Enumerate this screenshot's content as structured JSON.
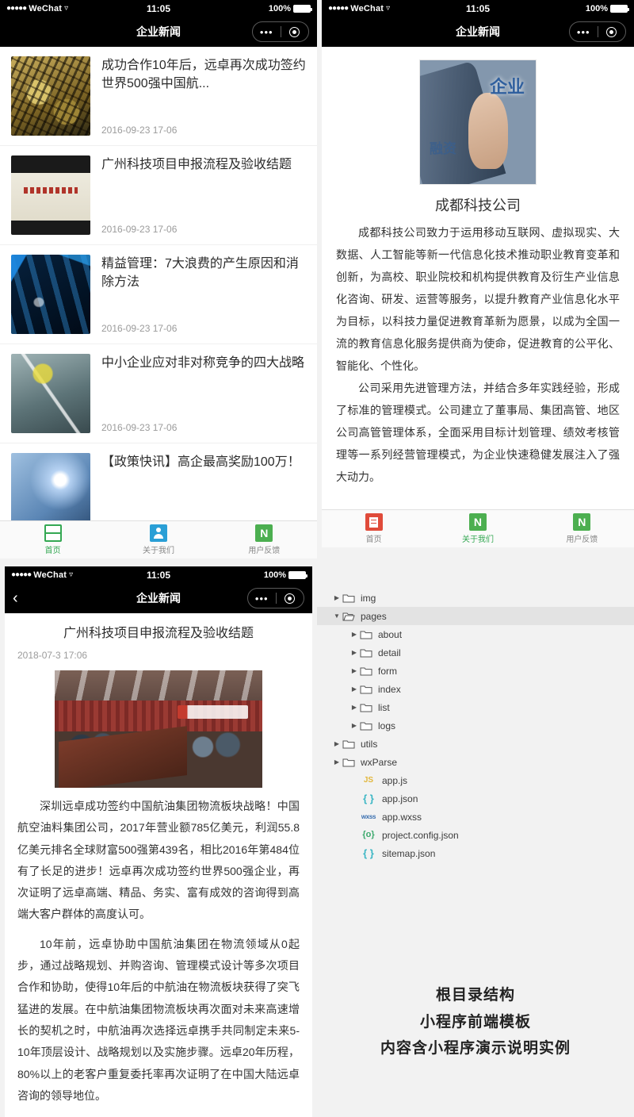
{
  "status_bar": {
    "carrier_dots": "●●●●●",
    "carrier": "WeChat",
    "wifi_icon": "wifi-icon",
    "time": "11:05",
    "battery_percent": "100%"
  },
  "capsule": {
    "menu_icon": "more-dots-icon",
    "close_icon": "target-circle-icon"
  },
  "panel_list": {
    "nav_title": "企业新闻",
    "items": [
      {
        "title": "成功合作10年后，远卓再次成功签约世界500强中国航...",
        "date": "2016-09-23 17-06",
        "thumb": "circuit-board-thumb"
      },
      {
        "title": "广州科技项目申报流程及验收结题",
        "date": "2016-09-23 17-06",
        "thumb": "award-sign-thumb"
      },
      {
        "title": "精益管理：7大浪费的产生原因和消除方法",
        "date": "2016-09-23 17-06",
        "thumb": "blue-touch-thumb"
      },
      {
        "title": "中小企业应对非对称竞争的四大战略",
        "date": "2016-09-23 17-06",
        "thumb": "businessman-chart-thumb"
      },
      {
        "title": "【政策快讯】高企最高奖励100万！",
        "date": "",
        "thumb": "light-burst-thumb"
      }
    ],
    "tabs": [
      {
        "label": "首页",
        "icon": "list-icon",
        "active": true
      },
      {
        "label": "关于我们",
        "icon": "person-icon",
        "active": false
      },
      {
        "label": "用户反馈",
        "icon": "n-letter-icon",
        "active": false
      }
    ]
  },
  "panel_about": {
    "nav_title": "企业新闻",
    "hero_image": {
      "name": "finger-touching-screen-photo",
      "overlay_text_primary": "企业",
      "overlay_text_secondary": "融资"
    },
    "title": "成都科技公司",
    "paragraphs": [
      "成都科技公司致力于运用移动互联网、虚拟现实、大数据、人工智能等新一代信息化技术推动职业教育变革和创新，为高校、职业院校和机构提供教育及衍生产业信息化咨询、研发、运营等服务，以提升教育产业信息化水平为目标，以科技力量促进教育革新为愿景，以成为全国一流的教育信息化服务提供商为使命，促进教育的公平化、智能化、个性化。",
      "公司采用先进管理方法，并结合多年实践经验，形成了标准的管理模式。公司建立了董事局、集团高管、地区公司高管管理体系，全面采用目标计划管理、绩效考核管理等一系列经营管理模式，为企业快速稳健发展注入了强大动力。"
    ],
    "tabs": [
      {
        "label": "首页",
        "icon": "document-icon",
        "active": false
      },
      {
        "label": "关于我们",
        "icon": "n-letter-icon",
        "active": true
      },
      {
        "label": "用户反馈",
        "icon": "n-letter-icon",
        "active": false
      }
    ]
  },
  "panel_detail": {
    "nav_title": "企业新闻",
    "back_icon": "chevron-left-icon",
    "title": "广州科技项目申报流程及验收结题",
    "date": "2018-07-3 17:06",
    "photo": "conference-room-meeting-photo",
    "paragraphs": [
      "深圳远卓成功签约中国航油集团物流板块战略！中国航空油料集团公司，2017年营业额785亿美元，利润55.8亿美元排名全球财富500强第439名，相比2016年第484位有了长足的进步！远卓再次成功签约世界500强企业，再次证明了远卓高端、精品、务实、富有成效的咨询得到高端大客户群体的高度认可。",
      "10年前，远卓协助中国航油集团在物流领域从0起步，通过战略规划、并购咨询、管理模式设计等多次项目合作和协助，使得10年后的中航油在物流板块获得了突飞猛进的发展。在中航油集团物流板块再次面对未来高速增长的契机之时，中航油再次选择远卓携手共同制定未来5-10年顶层设计、战略规划以及实施步骤。远卓20年历程，80%以上的老客户重复委托率再次证明了在中国大陆远卓咨询的领导地位。"
    ]
  },
  "panel_tree": {
    "nodes": [
      {
        "name": "img",
        "type": "folder",
        "depth": 1,
        "expanded": false,
        "selected": false
      },
      {
        "name": "pages",
        "type": "folder",
        "depth": 1,
        "expanded": true,
        "selected": true
      },
      {
        "name": "about",
        "type": "folder",
        "depth": 2,
        "expanded": false,
        "selected": false
      },
      {
        "name": "detail",
        "type": "folder",
        "depth": 2,
        "expanded": false,
        "selected": false
      },
      {
        "name": "form",
        "type": "folder",
        "depth": 2,
        "expanded": false,
        "selected": false
      },
      {
        "name": "index",
        "type": "folder",
        "depth": 2,
        "expanded": false,
        "selected": false
      },
      {
        "name": "list",
        "type": "folder",
        "depth": 2,
        "expanded": false,
        "selected": false
      },
      {
        "name": "logs",
        "type": "folder",
        "depth": 2,
        "expanded": false,
        "selected": false
      },
      {
        "name": "utils",
        "type": "folder",
        "depth": 1,
        "expanded": false,
        "selected": false
      },
      {
        "name": "wxParse",
        "type": "folder",
        "depth": 1,
        "expanded": false,
        "selected": false
      },
      {
        "name": "app.js",
        "type": "js",
        "depth": 2,
        "icon_text": "JS",
        "selected": false
      },
      {
        "name": "app.json",
        "type": "json",
        "depth": 2,
        "icon_text": "{ }",
        "selected": false
      },
      {
        "name": "app.wxss",
        "type": "wxss",
        "depth": 2,
        "icon_text": "wxss",
        "selected": false
      },
      {
        "name": "project.config.json",
        "type": "cfg",
        "depth": 2,
        "icon_text": "{o}",
        "selected": false
      },
      {
        "name": "sitemap.json",
        "type": "json",
        "depth": 2,
        "icon_text": "{ }",
        "selected": false
      }
    ],
    "caption_lines": [
      "根目录结构",
      "小程序前端模板",
      "内容含小程序演示说明实例"
    ]
  },
  "colors": {
    "nav_bg": "#000000",
    "accent_green": "#34a853",
    "accent_blue": "#2a9fd6",
    "accent_red": "#e04b3a",
    "page_bg": "#f2f2f2"
  }
}
